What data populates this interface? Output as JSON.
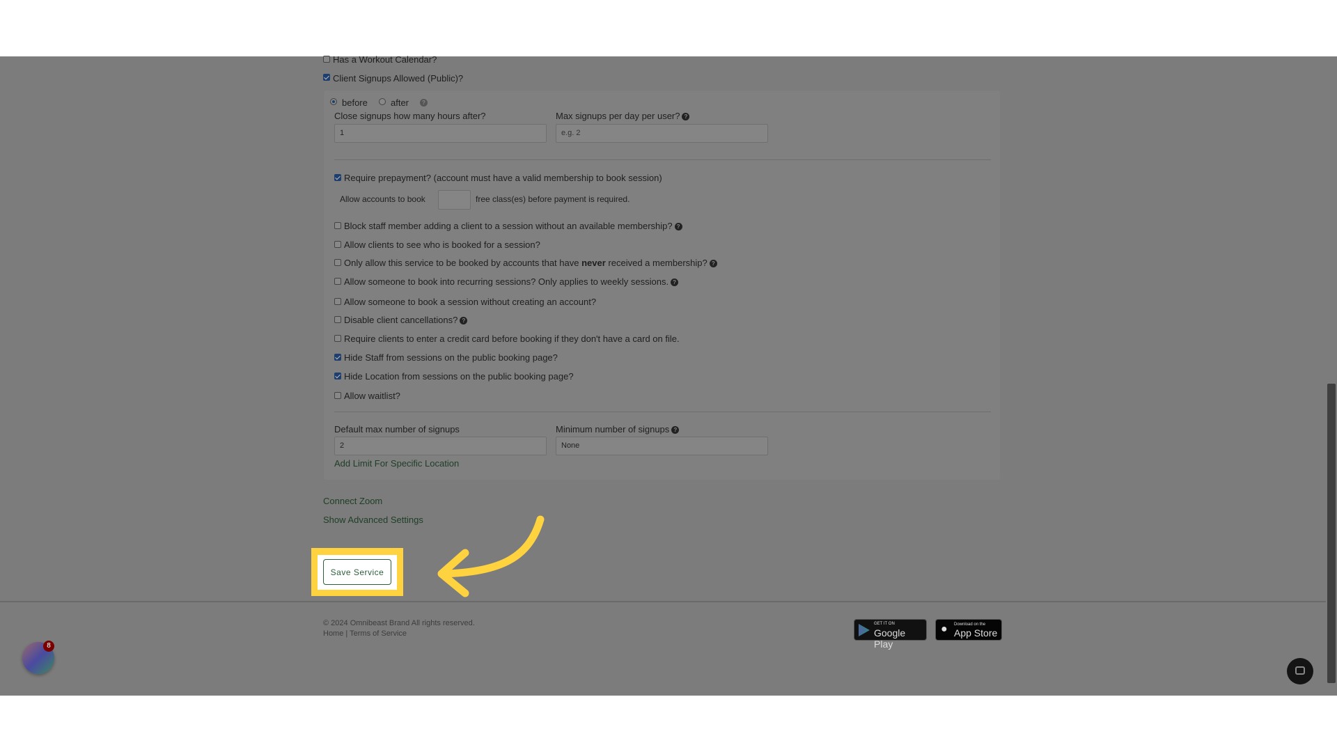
{
  "form": {
    "workout_calendar": {
      "label": "Has a Workout Calendar?",
      "checked": false
    },
    "client_signups": {
      "label": "Client Signups Allowed (Public)?",
      "checked": true
    },
    "timing": {
      "before": "before",
      "after": "after",
      "selected": "before"
    },
    "close_signups": {
      "label": "Close signups how many hours after?",
      "value": "1"
    },
    "max_signups": {
      "label": "Max signups per day per user?",
      "placeholder": "e.g. 2"
    },
    "prepayment": {
      "label": "Require prepayment? (account must have a valid membership to book session)",
      "checked": true
    },
    "free_classes": {
      "prefix": "Allow accounts to book",
      "suffix": "free class(es) before payment is required.",
      "value": ""
    },
    "options": [
      {
        "label": "Block staff member adding a client to a session without an available membership?",
        "checked": false,
        "help": true
      },
      {
        "label": "Allow clients to see who is booked for a session?",
        "checked": false
      },
      {
        "label_pre": "Only allow this service to be booked by accounts that have ",
        "label_bold": "never",
        "label_post": " received a membership?",
        "checked": false,
        "help": true
      },
      {
        "label": "Allow someone to book into recurring sessions? Only applies to weekly sessions.",
        "checked": false,
        "help": true
      },
      {
        "label": "Allow someone to book a session without creating an account?",
        "checked": false
      },
      {
        "label": "Disable client cancellations?",
        "checked": false,
        "help": true
      },
      {
        "label": "Require clients to enter a credit card before booking if they don't have a card on file.",
        "checked": false
      },
      {
        "label": "Hide Staff from sessions on the public booking page?",
        "checked": true
      },
      {
        "label": "Hide Location from sessions on the public booking page?",
        "checked": true
      },
      {
        "label": "Allow waitlist?",
        "checked": false
      }
    ],
    "default_max": {
      "label": "Default max number of signups",
      "value": "2"
    },
    "min_signups": {
      "label": "Minimum number of signups",
      "value": "None"
    },
    "add_limit": "Add Limit For Specific Location",
    "connect_zoom": "Connect Zoom",
    "advanced": "Show Advanced Settings",
    "save": "Save Service"
  },
  "footer": {
    "copyright": "© 2024 Omnibeast Brand All rights reserved.",
    "home": "Home",
    "sep": "|",
    "terms": "Terms of Service",
    "google_small": "GET IT ON",
    "google_big": "Google Play",
    "apple_small": "Download on the",
    "apple_big": "App Store"
  },
  "widget": {
    "badge": "8"
  },
  "colors": {
    "highlight": "#ffd23f",
    "link": "#1d5e32",
    "overlay": "#7c7c7c"
  }
}
